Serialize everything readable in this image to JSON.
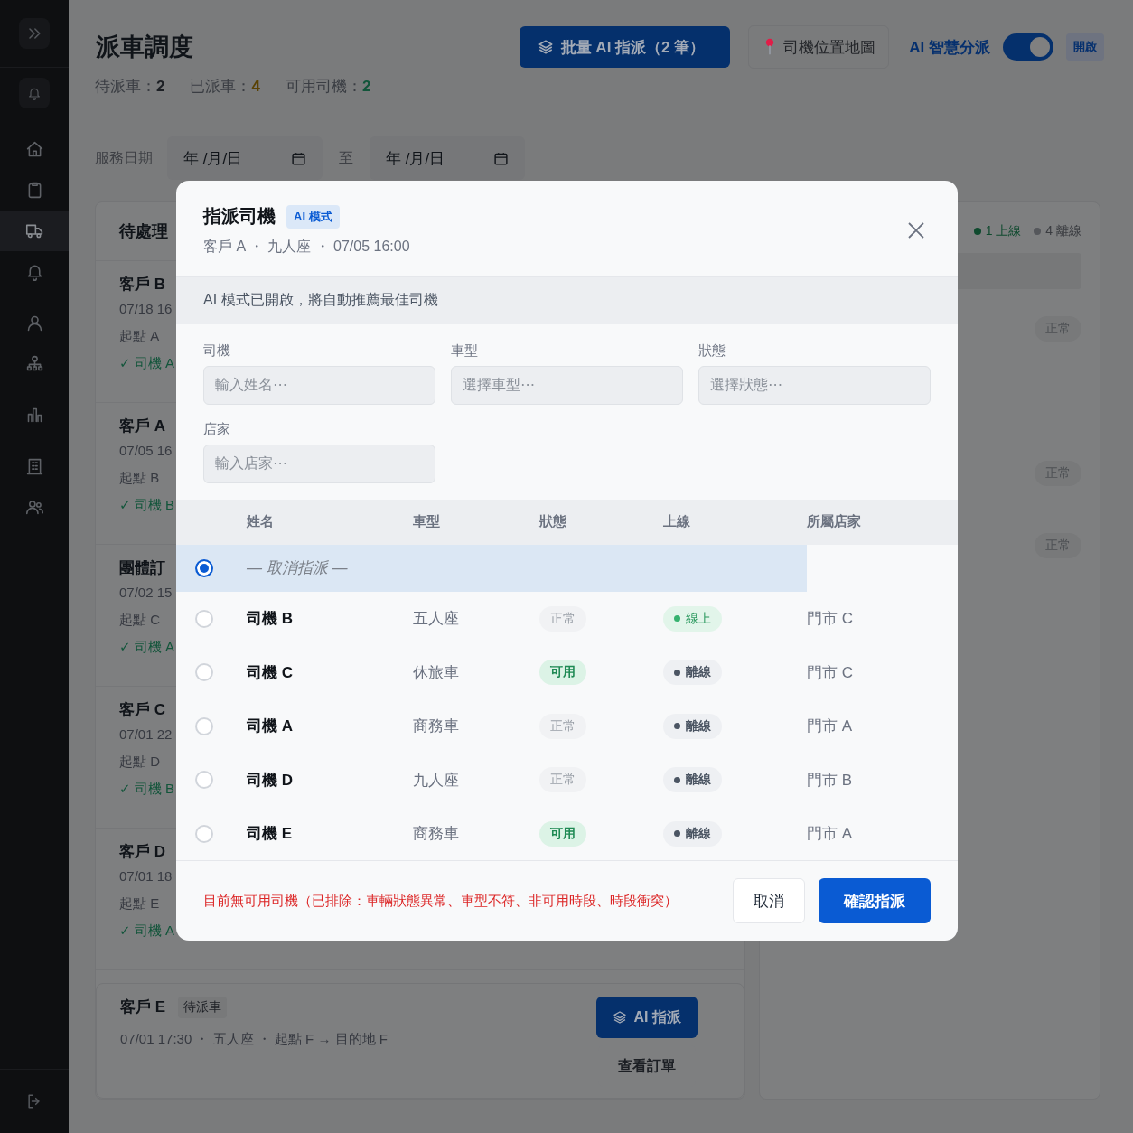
{
  "sidebar": {
    "groups": [
      {
        "items": [
          {
            "selected": false
          },
          {
            "selected": false
          },
          {
            "selected": true
          },
          {
            "selected": false
          }
        ]
      },
      {
        "items": [
          {
            "selected": false
          },
          {
            "selected": false
          }
        ]
      },
      {
        "items": [
          {
            "selected": false
          }
        ]
      },
      {
        "items": [
          {
            "selected": false
          },
          {
            "selected": false
          }
        ]
      }
    ]
  },
  "header": {
    "title": "派車調度",
    "stats": [
      {
        "label": "待派車：",
        "value": "2",
        "color": "#1c1f24"
      },
      {
        "label": "已派車：",
        "value": "4",
        "color": "#5a4204"
      },
      {
        "label": "可用司機：",
        "value": "2",
        "color": "#12553a"
      }
    ]
  },
  "actions": {
    "batch_button": "批量 AI 指派（2 筆）",
    "map_button": "司機位置地圖",
    "ai_dispatch": {
      "label": "AI 智慧分派",
      "on": true,
      "status": "開啟"
    }
  },
  "date_filter": {
    "label": "服務日期",
    "from": {
      "placeholder": "年 /月/日"
    },
    "separator": "至",
    "to": {
      "placeholder": "年 /月/日"
    }
  },
  "pending_panel": {
    "title": "待處理",
    "orders": [
      {
        "kind": "assigned",
        "customer": "客戶 B",
        "time": "07/18 16",
        "route": "起點 A",
        "driver": "✓ 司機 A"
      },
      {
        "kind": "assigned",
        "customer": "客戶 A",
        "time": "07/05 16",
        "route": "起點 B",
        "driver": "✓ 司機 B"
      },
      {
        "kind": "assigned",
        "customer": "團體訂",
        "time": "07/02 15",
        "route": "起點 C",
        "driver": "✓ 司機 A"
      },
      {
        "kind": "assigned",
        "customer": "客戶 C",
        "time": "07/01 22",
        "route": "起點 D",
        "driver": "✓ 司機 B"
      },
      {
        "kind": "assigned",
        "customer": "客戶 D",
        "time": "07/01 18",
        "route": "起點 E",
        "driver": "✓ 司機 A"
      },
      {
        "kind": "pending",
        "customer": "客戶 E",
        "badge": "待派車",
        "details": "07/01 17:30 ・ 五人座 ・ 起點 F → 目的地 F",
        "buttons": [
          "AI 指派",
          "查看訂單"
        ]
      }
    ]
  },
  "drivers_panel": {
    "summary": [
      {
        "text": "1 上線",
        "color": "#0f4a2e"
      },
      {
        "text": "4 離線",
        "color": "#55575b"
      }
    ],
    "rows": [
      {
        "status": "正常"
      },
      {
        "status": "正常"
      },
      {
        "status": "正常"
      }
    ]
  },
  "dialog": {
    "title": "指派司機",
    "mode_badge": "AI 模式",
    "subtitle": "客戶 A ・ 九人座 ・ 07/05 16:00",
    "notice": "AI 模式已開啟，將自動推薦最佳司機",
    "filters": [
      {
        "label": "司機",
        "placeholder": "輸入姓名⋯"
      },
      {
        "label": "車型",
        "placeholder": "選擇車型⋯"
      },
      {
        "label": "狀態",
        "placeholder": "選擇狀態⋯"
      },
      {
        "label": "店家",
        "placeholder": "輸入店家⋯"
      }
    ],
    "columns": [
      "姓名",
      "車型",
      "狀態",
      "上線",
      "所屬店家"
    ],
    "unassign": {
      "label": "— 取消指派 —",
      "selected": true
    },
    "drivers": [
      {
        "name": "司機 B",
        "vehicle": "五人座",
        "status": {
          "kind": "normal",
          "text": "正常"
        },
        "online": {
          "on": true,
          "text": "線上"
        },
        "store": "門市 C",
        "selected": false
      },
      {
        "name": "司機 C",
        "vehicle": "休旅車",
        "status": {
          "kind": "available",
          "text": "可用"
        },
        "online": {
          "on": false,
          "text": "離線"
        },
        "store": "門市 C",
        "selected": false
      },
      {
        "name": "司機 A",
        "vehicle": "商務車",
        "status": {
          "kind": "normal",
          "text": "正常"
        },
        "online": {
          "on": false,
          "text": "離線"
        },
        "store": "門市 A",
        "selected": false
      },
      {
        "name": "司機 D",
        "vehicle": "九人座",
        "status": {
          "kind": "normal",
          "text": "正常"
        },
        "online": {
          "on": false,
          "text": "離線"
        },
        "store": "門市 B",
        "selected": false
      },
      {
        "name": "司機 E",
        "vehicle": "商務車",
        "status": {
          "kind": "available",
          "text": "可用"
        },
        "online": {
          "on": false,
          "text": "離線"
        },
        "store": "門市 A",
        "selected": false
      }
    ],
    "message": "目前無可用司機（已排除：車輛狀態異常、車型不符、非可用時段、時段衝突）",
    "buttons": {
      "cancel": "取消",
      "confirm": "確認指派"
    }
  }
}
